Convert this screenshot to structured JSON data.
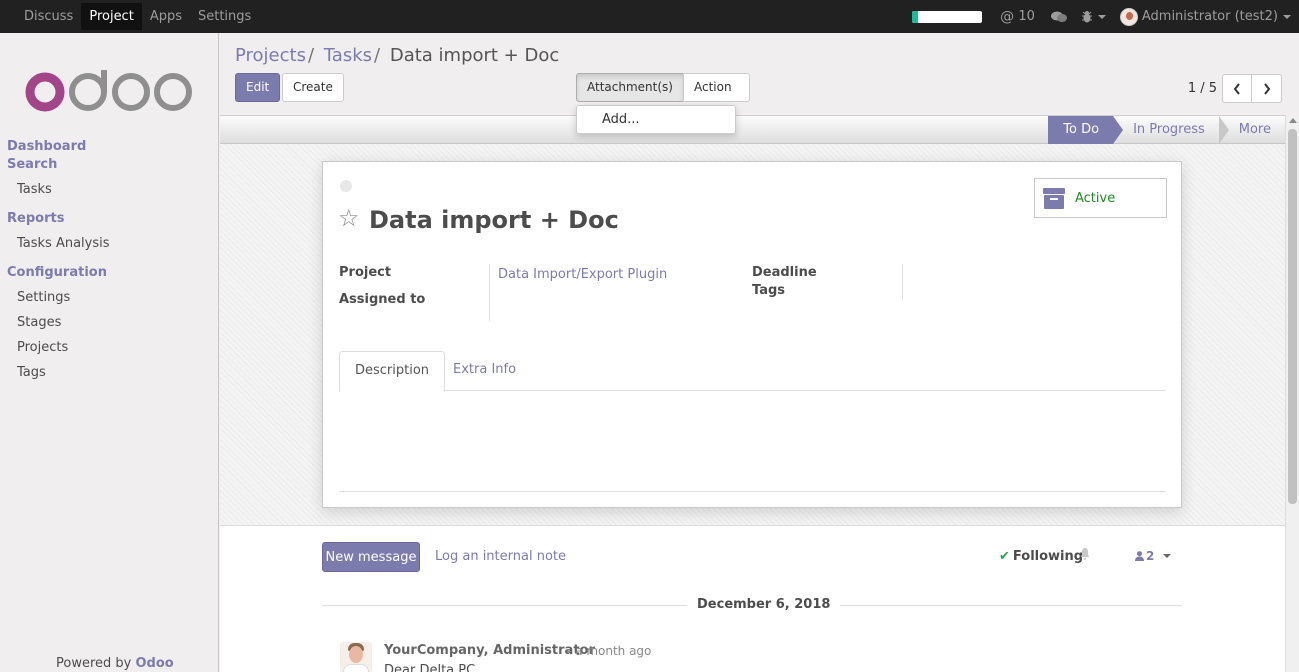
{
  "topbar": {
    "menu": [
      "Discuss",
      "Project",
      "Apps",
      "Settings"
    ],
    "active_menu": "Project",
    "progress_fraction": 0.08,
    "mentions_count": "10",
    "user": "Administrator (test2)"
  },
  "sidebar": {
    "sections": [
      {
        "title": "Dashboard"
      },
      {
        "title": "Search",
        "items": [
          "Tasks"
        ]
      },
      {
        "title": "Reports",
        "items": [
          "Tasks Analysis"
        ]
      },
      {
        "title": "Configuration",
        "items": [
          "Settings",
          "Stages",
          "Projects",
          "Tags"
        ]
      }
    ],
    "powered_prefix": "Powered by",
    "powered_brand": "Odoo"
  },
  "breadcrumb": {
    "items": [
      "Projects",
      "Tasks"
    ],
    "separator": "/",
    "current": "Data import + Doc"
  },
  "toolbar": {
    "edit": "Edit",
    "create": "Create",
    "attachments": "Attachment(s)",
    "action": "Action",
    "attachments_menu": [
      "Add..."
    ]
  },
  "pager": {
    "value": "1 / 5"
  },
  "stages": [
    "To Do",
    "In Progress",
    "More"
  ],
  "active_stage": "To Do",
  "form": {
    "title": "Data import + Doc",
    "active_label": "Active",
    "fields": {
      "project_label": "Project",
      "project_value": "Data Import/Export Plugin",
      "assigned_label": "Assigned to",
      "deadline_label": "Deadline",
      "tags_label": "Tags"
    },
    "tabs": [
      "Description",
      "Extra Info"
    ]
  },
  "chatter": {
    "new_message": "New message",
    "log_note": "Log an internal note",
    "following": "Following",
    "followers_count": "2",
    "date": "December 6, 2018",
    "message": {
      "author": "YourCompany, Administrator",
      "time": "- a month ago",
      "body": "Dear Delta PC,"
    }
  },
  "colors": {
    "brand": "#7c7bad",
    "topbar": "#212121",
    "active_green": "#1e8a24"
  }
}
